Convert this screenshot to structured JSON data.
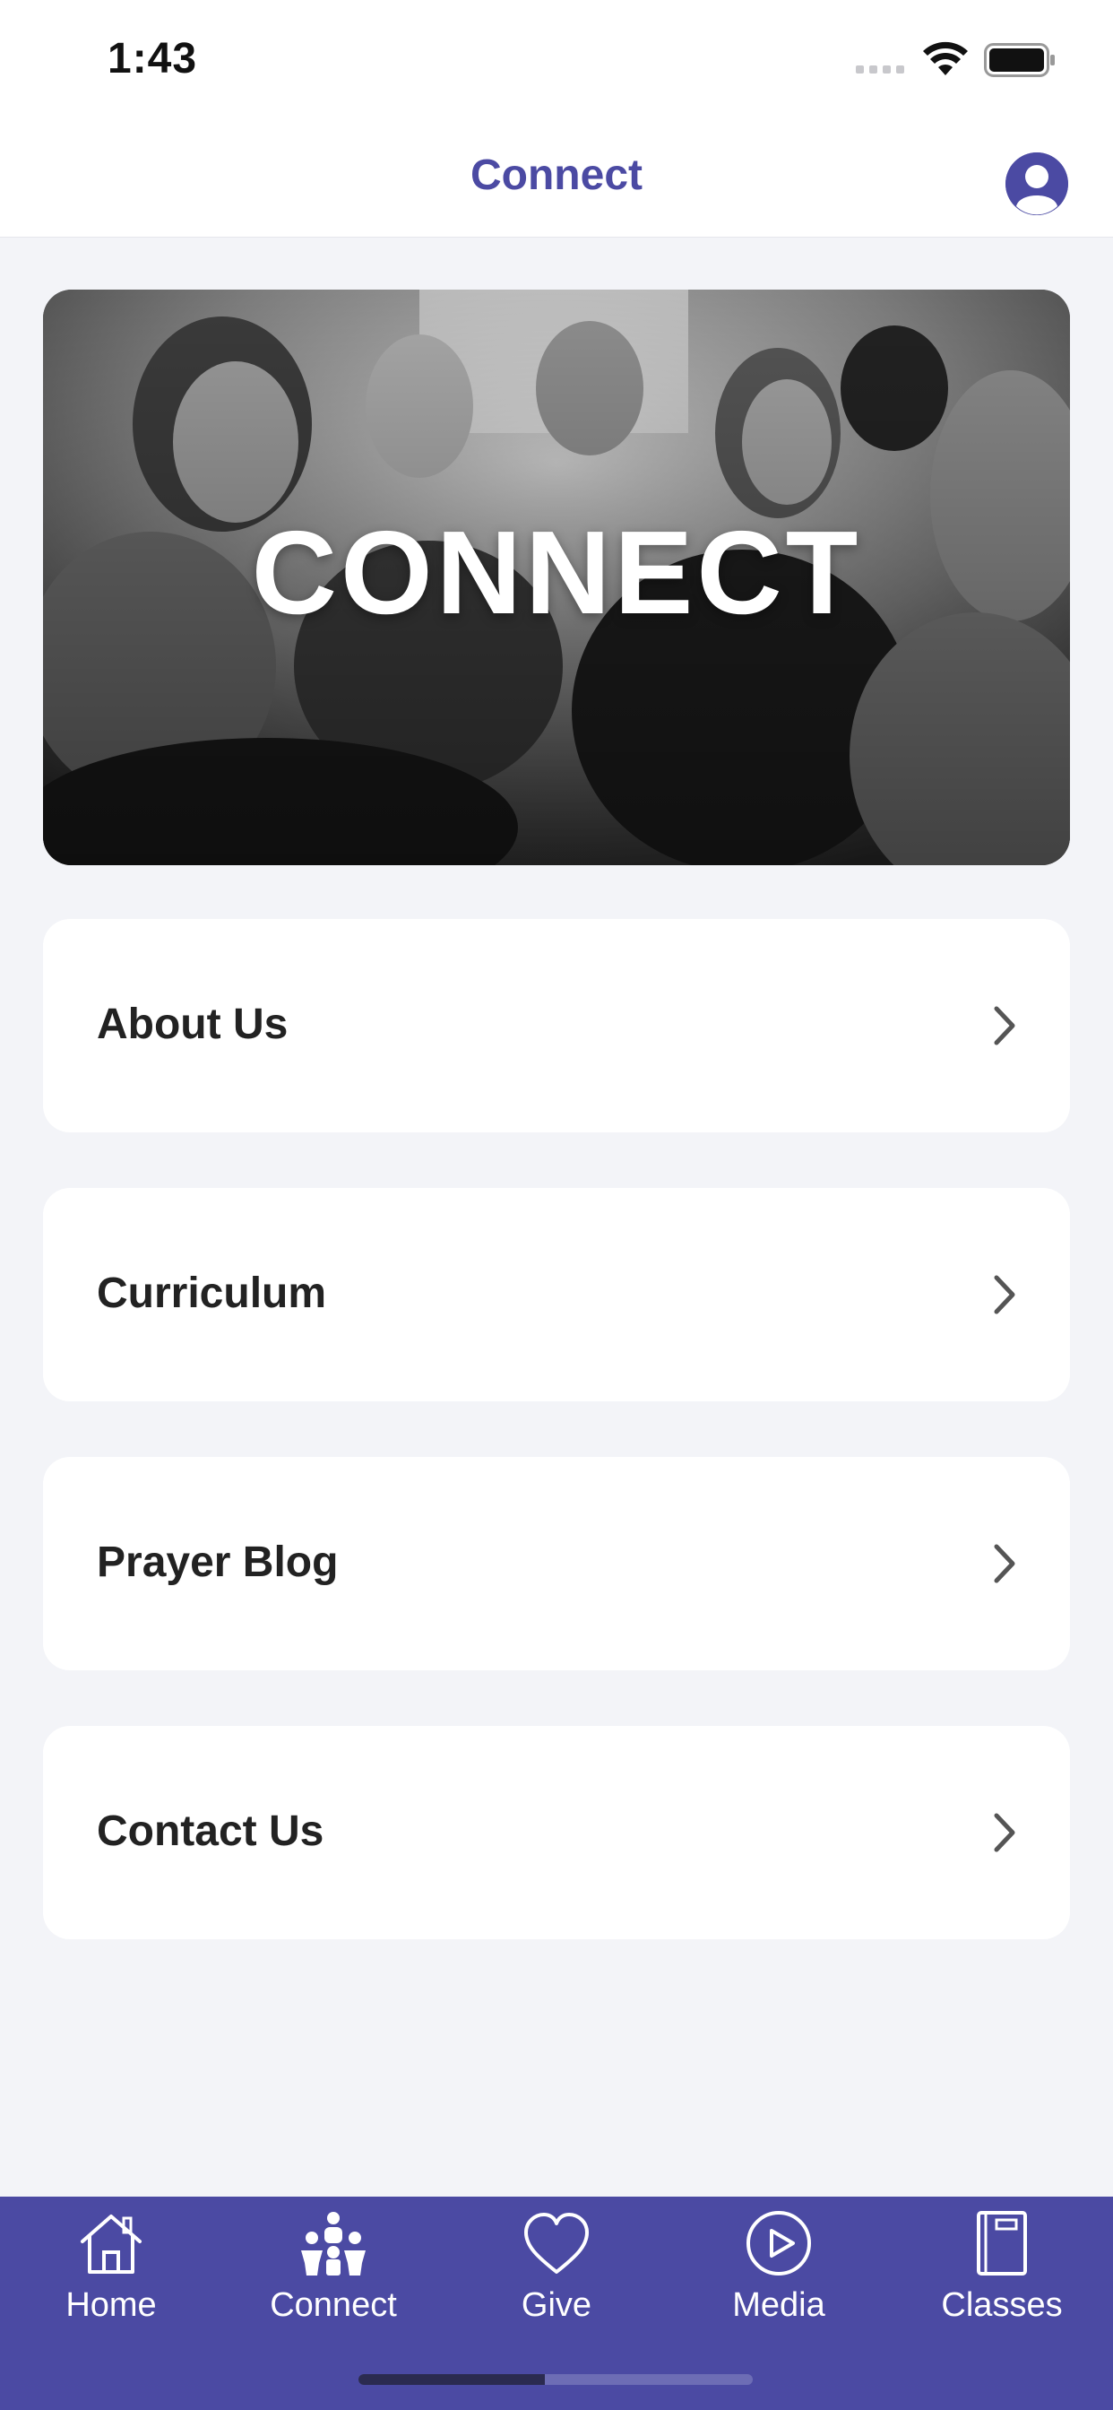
{
  "status_bar": {
    "time": "1:43"
  },
  "header": {
    "title": "Connect"
  },
  "hero": {
    "title": "CONNECT"
  },
  "menu": {
    "items": [
      {
        "label": "About Us"
      },
      {
        "label": "Curriculum"
      },
      {
        "label": "Prayer Blog"
      },
      {
        "label": "Contact Us"
      }
    ]
  },
  "tab_bar": {
    "tabs": [
      {
        "label": "Home",
        "icon": "home-icon"
      },
      {
        "label": "Connect",
        "icon": "people-icon"
      },
      {
        "label": "Give",
        "icon": "heart-icon"
      },
      {
        "label": "Media",
        "icon": "play-icon"
      },
      {
        "label": "Classes",
        "icon": "book-icon"
      }
    ],
    "active": "Connect"
  },
  "colors": {
    "accent": "#4b4aa3",
    "background": "#f3f4f8",
    "card": "#ffffff",
    "text": "#222222"
  }
}
